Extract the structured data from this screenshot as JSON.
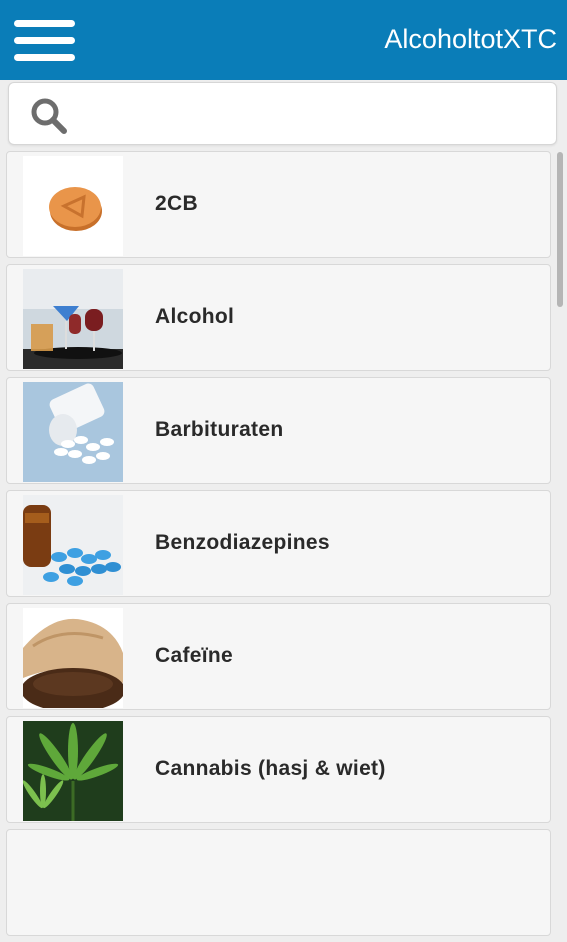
{
  "app": {
    "title": "AlcoholtotXTC"
  },
  "search": {
    "placeholder": "",
    "value": ""
  },
  "items": [
    {
      "label": "2CB",
      "icon": "orange-pill-image"
    },
    {
      "label": "Alcohol",
      "icon": "glasses-image"
    },
    {
      "label": "Barbituraten",
      "icon": "white-pills-image"
    },
    {
      "label": "Benzodiazepines",
      "icon": "blue-pills-image"
    },
    {
      "label": "Cafeïne",
      "icon": "coffee-grounds-image"
    },
    {
      "label": "Cannabis (hasj & wiet)",
      "icon": "cannabis-leaf-image"
    }
  ],
  "colors": {
    "appbar": "#0a7db8",
    "itemBackground": "#f6f6f6",
    "text": "#2a2a2a"
  }
}
